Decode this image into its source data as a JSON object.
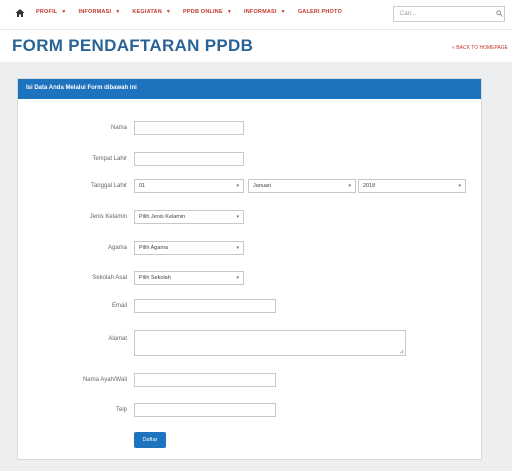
{
  "nav": {
    "items": [
      {
        "label": "PROFIL",
        "has_caret": true
      },
      {
        "label": "INFORMASI",
        "has_caret": true
      },
      {
        "label": "KEGIATAN",
        "has_caret": true
      },
      {
        "label": "PPDB ONLINE",
        "has_caret": true
      },
      {
        "label": "INFORMASI",
        "has_caret": true
      },
      {
        "label": "GALERI PHOTO",
        "has_caret": false
      }
    ],
    "search_placeholder": "Cari..."
  },
  "page": {
    "title": "FORM PENDAFTARAN PPDB",
    "back_link": "« BACK TO HOMEPAGE"
  },
  "panel": {
    "header": "Isi Data Anda Melalui Form dibawah ini"
  },
  "form": {
    "nama_label": "Nama",
    "tempat_lahir_label": "Tempat Lahir",
    "tanggal_lahir_label": "Tanggal Lahir",
    "tanggal_day": "01",
    "tanggal_month": "Januari",
    "tanggal_year": "2018",
    "jenis_kelamin_label": "Jenis Kelamin",
    "jenis_kelamin_value": "Pilih Jenis Kelamin",
    "agama_label": "Agama",
    "agama_value": "Pilih Agama",
    "sekolah_asal_label": "Sekolah Asal",
    "sekolah_asal_value": "Pilih Sekolah",
    "email_label": "Email",
    "alamat_label": "Alamat",
    "nama_ayah_label": "Nama Ayah/Wali",
    "telp_label": "Telp",
    "submit_label": "Daftar"
  },
  "colors": {
    "nav_text": "#c0392b",
    "title": "#2a6496",
    "panel_header": "#1e73be",
    "button": "#1e73be",
    "background_band": "#eceef0"
  }
}
